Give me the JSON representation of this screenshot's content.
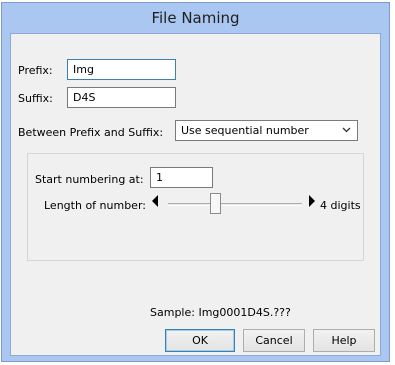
{
  "window": {
    "title": "File Naming"
  },
  "prefix": {
    "label": "Prefix:",
    "value": "Img"
  },
  "suffix": {
    "label": "Suffix:",
    "value": "D4S"
  },
  "between": {
    "label": "Between Prefix and Suffix:",
    "selected": "Use sequential number"
  },
  "numbering": {
    "start_label": "Start numbering at:",
    "start_value": "1",
    "length_label": "Length of number:",
    "length_value_text": "4 digits"
  },
  "sample": {
    "text": "Sample: Img0001D4S.???"
  },
  "buttons": {
    "ok": "OK",
    "cancel": "Cancel",
    "help": "Help"
  }
}
